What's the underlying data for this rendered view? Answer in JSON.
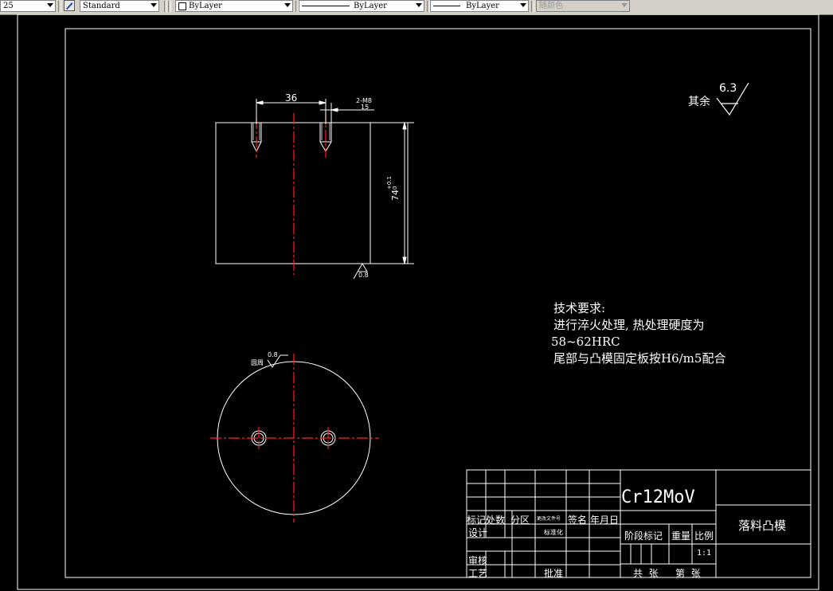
{
  "toolbar": {
    "lineweight_value": "25",
    "textstyle_value": "Standard",
    "layer_value": "ByLayer",
    "linetype_value": "ByLayer",
    "lineweight2_value": "ByLayer",
    "plotstyle_value": "随颜色"
  },
  "drawing": {
    "dim_36": "36",
    "dim_thread_top": "2-M8",
    "dim_thread_bottom": "15",
    "dim_height": "74",
    "dim_height_tol_upper": "+0.1",
    "dim_height_tol_lower": "0",
    "roughness_bottom": "0.8",
    "roughness_circ_value": "0.8",
    "roughness_circ_label": "圆周",
    "roughness_general_label": "其余",
    "roughness_general_value": "6.3"
  },
  "requirements": {
    "title": "技术要求:",
    "line1": "进行淬火处理, 热处理硬度为",
    "line2": "58~62HRC",
    "line3": "尾部与凸模固定板按H6/m5配合"
  },
  "title_block": {
    "material": "Cr12MoV",
    "part_name": "落料凸模",
    "h_mark": "标记",
    "h_count": "处数",
    "h_zone": "分区",
    "h_change_doc": "更改文件号",
    "h_sign": "签名",
    "h_date": "年月日",
    "design": "设计",
    "standardize": "标准化",
    "review": "审核",
    "process": "工艺",
    "approve": "批准",
    "stage_mark": "阶段标记",
    "weight": "重量",
    "scale": "比例",
    "scale_value": "1:1",
    "total_sheets": "共  张",
    "sheet_no": "第  张"
  }
}
